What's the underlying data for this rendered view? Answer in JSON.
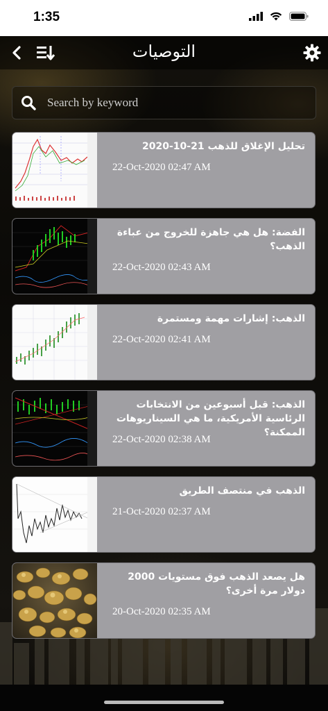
{
  "status": {
    "time": "1:35"
  },
  "nav": {
    "title": "التوصيات"
  },
  "search": {
    "placeholder": "Search by keyword"
  },
  "items": [
    {
      "title": "تحليل الإغلاق للذهب 21-10-2020",
      "date": "22-Oct-2020 02:47 AM",
      "thumb": "light-chart"
    },
    {
      "title": "الفضة: هل هي جاهزة للخروج من عباءة الذهب؟",
      "date": "22-Oct-2020 02:43 AM",
      "thumb": "dark-chart"
    },
    {
      "title": "الذهب: إشارات مهمة ومستمرة",
      "date": "22-Oct-2020 02:41 AM",
      "thumb": "light-chart"
    },
    {
      "title": "الذهب: قبل أسبوعين من الانتخابات الرئاسية الأمريكية، ما هي السيناريوهات الممكنة؟",
      "date": "22-Oct-2020 02:38 AM",
      "thumb": "dark-chart"
    },
    {
      "title": "الذهب في منتصف الطريق",
      "date": "21-Oct-2020 02:37 AM",
      "thumb": "light-chart"
    },
    {
      "title": "هل يصعد الذهب فوق مستويات 2000 دولار مرة أخرى؟",
      "date": "20-Oct-2020 02:35 AM",
      "thumb": "gold-nuggets-photo"
    }
  ]
}
